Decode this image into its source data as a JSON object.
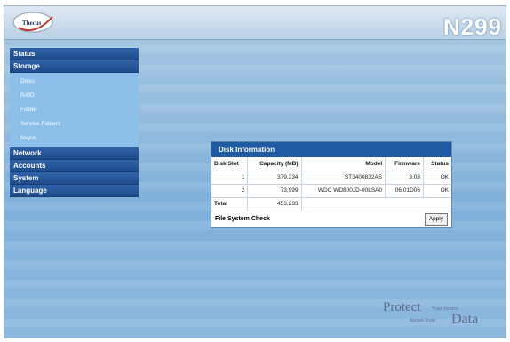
{
  "header": {
    "logo_text": "Thecus",
    "model": "N299"
  },
  "sidebar": {
    "sections": [
      {
        "label": "Status"
      },
      {
        "label": "Storage",
        "items": [
          "Disks",
          "RAID",
          "Folder",
          "Service Folders",
          "Nsync"
        ]
      },
      {
        "label": "Network"
      },
      {
        "label": "Accounts"
      },
      {
        "label": "System"
      },
      {
        "label": "Language"
      }
    ]
  },
  "disk_panel": {
    "title": "Disk Information",
    "columns": [
      "Disk Slot",
      "Capacity (MB)",
      "Model",
      "Firmware",
      "Status"
    ],
    "rows": [
      {
        "slot": "1",
        "capacity": "379,234",
        "model": "ST3400832AS",
        "firmware": "3.03",
        "status": "OK"
      },
      {
        "slot": "2",
        "capacity": "73,999",
        "model": "WDC WD800JD-00LSA0",
        "firmware": "06.01D06",
        "status": "OK"
      }
    ],
    "total_label": "Total",
    "total_value": "453,233",
    "fs_check_label": "File System Check",
    "apply_label": "Apply"
  },
  "tagline": {
    "protect": "Protect",
    "your_source": "Your Source",
    "secure_your": "Secure Your",
    "data": "Data"
  }
}
